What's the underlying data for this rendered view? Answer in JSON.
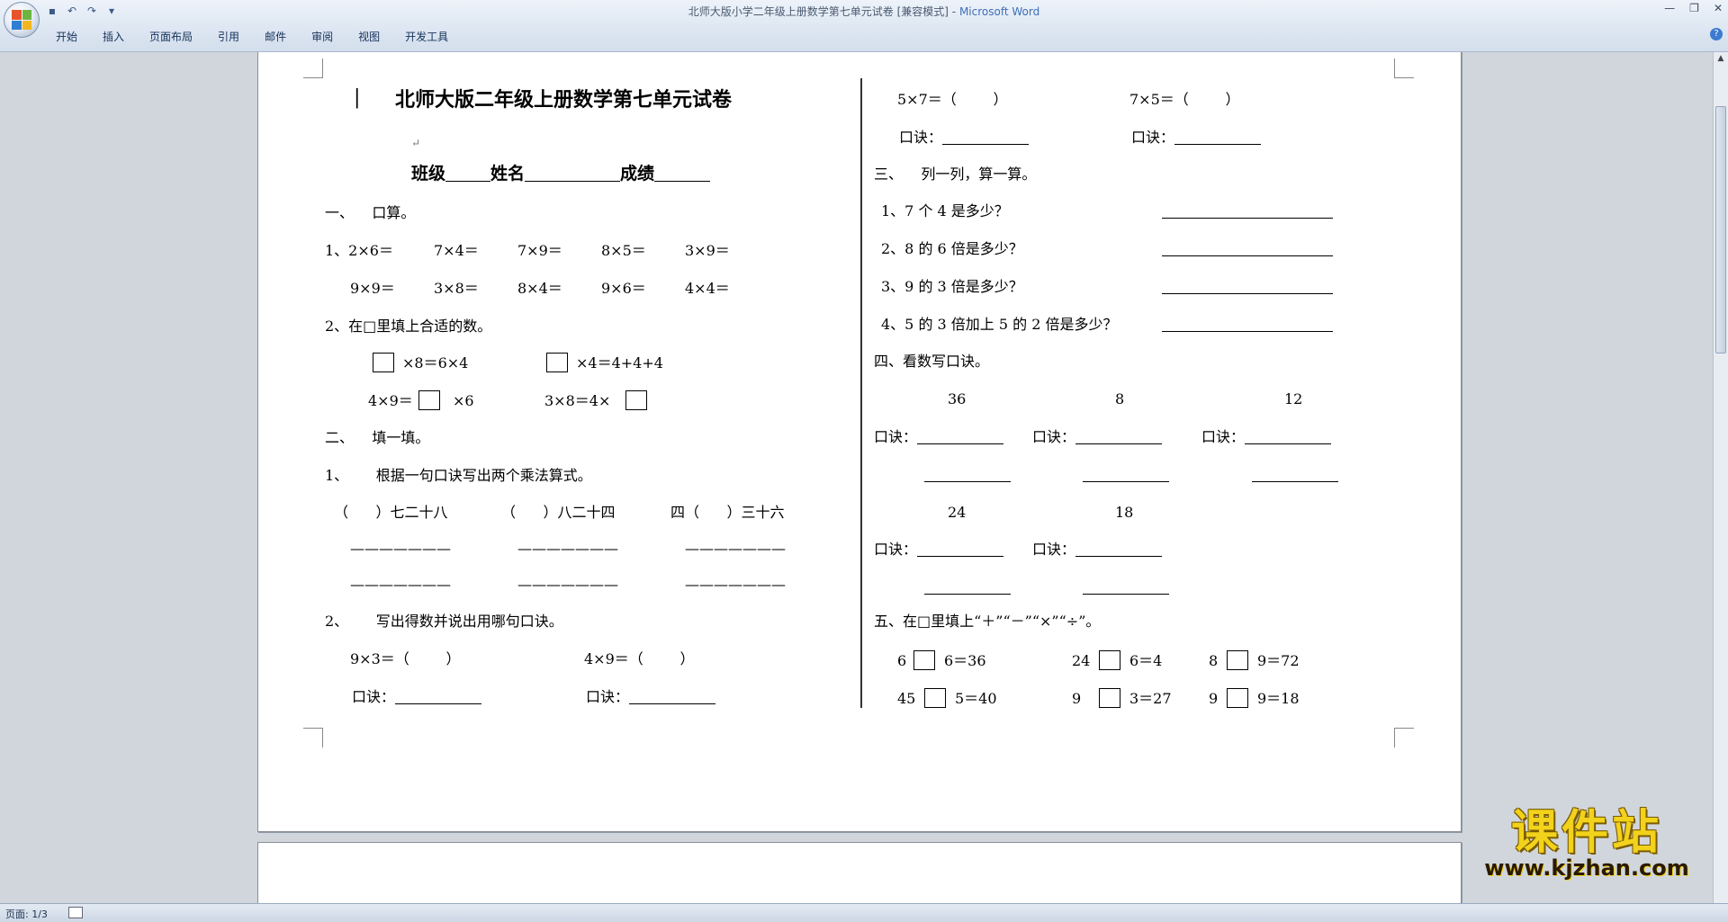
{
  "window": {
    "doc_title": "北师大版小学二年级上册数学第七单元试卷 [兼容模式]",
    "app_name": "Microsoft Word",
    "title_sep": " - "
  },
  "ribbon_tabs": [
    "开始",
    "插入",
    "页面布局",
    "引用",
    "邮件",
    "审阅",
    "视图",
    "开发工具"
  ],
  "status_bar": {
    "page": "页面: 1/3"
  },
  "watermark": {
    "text": "课件站",
    "url": "www.kjzhan.com"
  },
  "doc": {
    "title": "北师大版二年级上册数学第七单元试卷",
    "info": {
      "class": "班级",
      "name": "姓名",
      "score": "成绩"
    },
    "s1": {
      "heading": "一、    口算。",
      "row1": [
        "1、2×6＝",
        "7×4＝",
        "7×9＝",
        "8×5＝",
        "3×9＝"
      ],
      "row2": [
        "9×9＝",
        "3×8＝",
        "8×4＝",
        "9×6＝",
        "4×4＝"
      ],
      "q2": "2、在□里填上合适的数。",
      "eq1a": "×8＝6×4",
      "eq1b": "×4＝4+4+4",
      "eq2a_pre": "4×9＝",
      "eq2a_post": "×6",
      "eq2b_pre": "3×8＝4×"
    },
    "s2": {
      "heading": "二、    填一填。",
      "q1": "1、      根据一句口诀写出两个乘法算式。",
      "kj": [
        "（      ）七二十八",
        "（      ）八二十四",
        "四（      ）三十六"
      ],
      "dash": "———————",
      "q2": "2、      写出得数并说出用哪句口诀。",
      "e1": "9×3＝（        ）",
      "e2": "4×9＝（        ）",
      "kj_label": "口诀："
    },
    "right": {
      "e1": "5×7＝（        ）",
      "e2": "7×5＝（        ）",
      "s3": {
        "heading": "三、    列一列，算一算。",
        "qs": [
          "1、7 个 4 是多少？",
          "2、8 的 6 倍是多少？",
          "3、9 的 3 倍是多少？",
          "4、5 的 3 倍加上 5 的 2 倍是多少？"
        ]
      },
      "s4": {
        "heading": "四、看数写口诀。",
        "nums1": [
          "36",
          "8",
          "12"
        ],
        "nums2": [
          "24",
          "18"
        ]
      },
      "s5": {
        "heading": "五、在□里填上“＋”“－”“×”“÷”。",
        "r1": [
          [
            "6",
            "6＝36"
          ],
          [
            "24",
            "6＝4"
          ],
          [
            "8",
            "9＝72"
          ]
        ],
        "r2": [
          [
            "45",
            "5＝40"
          ],
          [
            "9",
            "3＝27"
          ],
          [
            "9",
            "9＝18"
          ]
        ]
      }
    }
  },
  "colors": {
    "accent": "#3d6fb4",
    "watermark": "#f2d21a"
  }
}
